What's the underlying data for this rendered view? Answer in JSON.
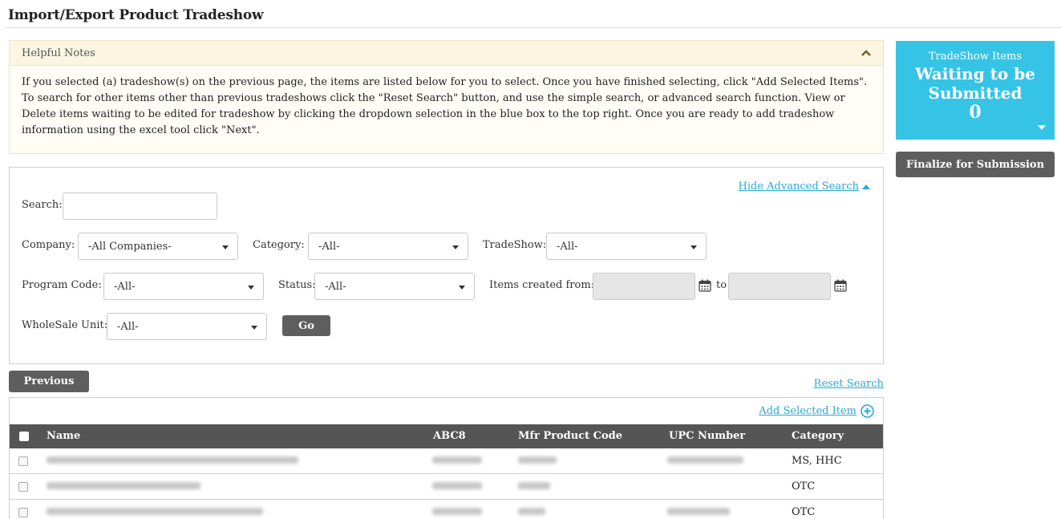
{
  "page": {
    "title": "Import/Export Product Tradeshow"
  },
  "notes": {
    "title": "Helpful Notes",
    "text": "If you selected (a) tradeshow(s) on the previous page, the items are listed below for you to select. Once you have finished selecting, click \"Add Selected Items\". To search for other items other than previous tradeshows click the \"Reset Search\" button, and use the simple search, or advanced search function. View or Delete items waiting to be edited for tradeshow by clicking the dropdown selection in the blue box to the top right. Once you are ready to add tradeshow information using the excel tool click \"Next\"."
  },
  "tradeshow_box": {
    "label": "TradeShow Items",
    "status": "Waiting to be Submitted",
    "count": "0",
    "color": "#36c4e6"
  },
  "finalize_label": "Finalize for Submission",
  "search": {
    "hide_advanced_label": "Hide Advanced Search",
    "search_label": "Search:",
    "search_value": "",
    "company_label": "Company:",
    "company_value": "-All Companies-",
    "category_label": "Category:",
    "category_value": "-All-",
    "tradeshow_label": "TradeShow:",
    "tradeshow_value": "-All-",
    "program_code_label": "Program Code:",
    "program_code_value": "-All-",
    "status_label": "Status:",
    "status_value": "-All-",
    "created_from_label": "Items created from:",
    "to_label": "to",
    "wholesale_label": "WholeSale Unit:",
    "wholesale_value": "-All-",
    "go_label": "Go"
  },
  "previous_label": "Previous",
  "reset_label": "Reset Search",
  "results": {
    "add_selected_label": "Add Selected Item",
    "columns": {
      "name": "Name",
      "abc8": "ABC8",
      "mfr": "Mfr Product Code",
      "upc": "UPC Number",
      "category": "Category"
    },
    "rows": [
      {
        "category": "MS, HHC"
      },
      {
        "category": "OTC"
      },
      {
        "category": "OTC"
      }
    ]
  },
  "icons": [
    "chevron-up-icon",
    "triangle-up-icon",
    "caret-down-icon",
    "calendar-icon",
    "plus-circle-icon",
    "checkbox-icon"
  ]
}
